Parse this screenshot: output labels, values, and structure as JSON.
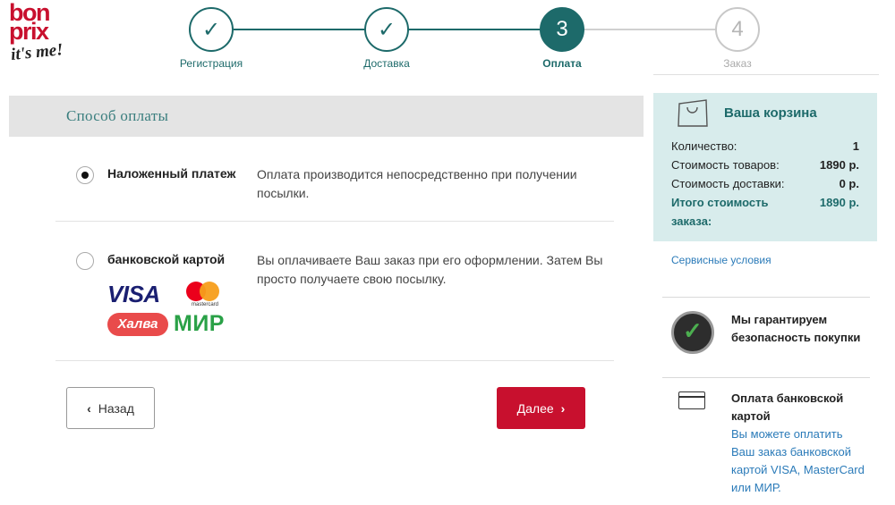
{
  "logo": {
    "line1": "bon",
    "line2": "prix",
    "line3": "it's me!"
  },
  "stepper": {
    "steps": [
      {
        "label": "Регистрация",
        "symbol": "✓",
        "state": "done"
      },
      {
        "label": "Доставка",
        "symbol": "✓",
        "state": "done"
      },
      {
        "label": "Оплата",
        "symbol": "3",
        "state": "active"
      },
      {
        "label": "Заказ",
        "symbol": "4",
        "state": "future"
      }
    ]
  },
  "payment": {
    "title": "Способ оплаты",
    "options": [
      {
        "name": "Наложенный платеж",
        "description": "Оплата производится непосредственно при получении посылки.",
        "selected": true
      },
      {
        "name": "банковской картой",
        "description": "Вы оплачиваете Ваш заказ при его оформлении. Затем Вы просто получаете свою посылку.",
        "selected": false,
        "logos": {
          "visa": "VISA",
          "mastercard": "mastercard",
          "halva": "Халва",
          "mir": "МИР"
        }
      }
    ]
  },
  "buttons": {
    "back": "Назад",
    "next": "Далее"
  },
  "cart": {
    "title": "Ваша корзина",
    "rows": [
      {
        "label": "Количество:",
        "value": "1"
      },
      {
        "label": "Стоимость товаров:",
        "value": "1890 р."
      },
      {
        "label": "Стоимость доставки:",
        "value": "0 р."
      }
    ],
    "total": {
      "label": "Итого стоимость заказа:",
      "value": "1890 р."
    }
  },
  "service_link": "Сервисные условия",
  "guarantee": {
    "text": "Мы гарантируем безопасность покупки"
  },
  "card_info": {
    "title": "Оплата банковской картой",
    "description": "Вы можете оплатить Ваш заказ банковской картой VISA, MasterCard или МИР."
  },
  "colors": {
    "accent": "#1d6a6a",
    "brand_red": "#c8102e",
    "link": "#2b7bb9"
  }
}
